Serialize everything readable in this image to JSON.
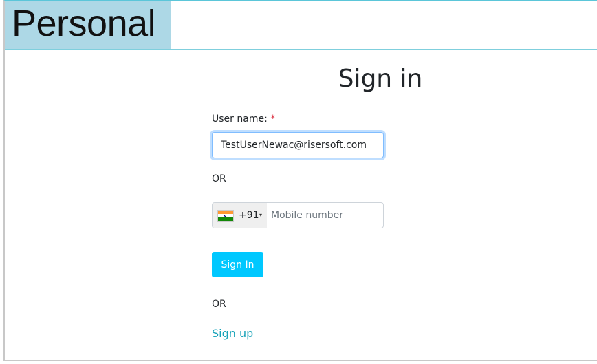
{
  "header": {
    "logo_text": "Personal"
  },
  "form": {
    "title": "Sign in",
    "username_label": "User name:",
    "required_marker": "*",
    "username_value": "TestUserNewac@risersoft.com",
    "or_text_1": "OR",
    "country_code": "+91",
    "country_flag": "India",
    "mobile_placeholder": "Mobile number",
    "signin_label": "Sign In",
    "or_text_2": "OR",
    "signup_label": "Sign up"
  },
  "colors": {
    "logo_bg": "#add8e6",
    "button_bg": "#00c8ff",
    "link": "#17a2b8",
    "required": "#dc3545"
  }
}
